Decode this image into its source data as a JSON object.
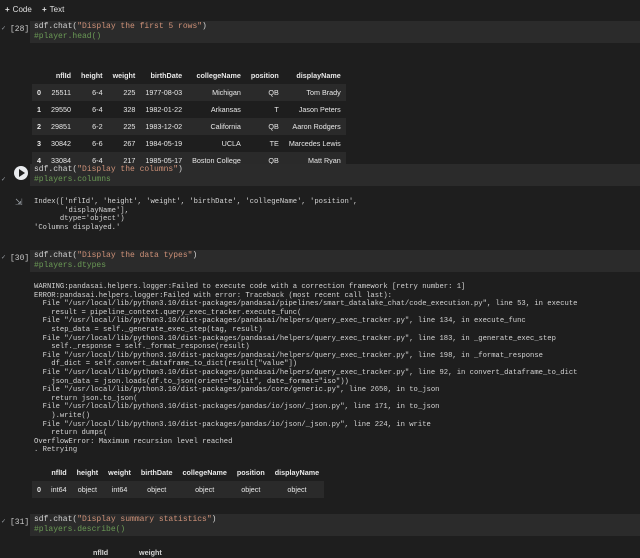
{
  "toolbar": {
    "add_code": "Code",
    "add_text": "Text"
  },
  "cells": {
    "c1": {
      "count": "[28]",
      "code1_fn": "sdf.chat(",
      "code1_str": "\"Display the first 5 rows\"",
      "code1_end": ")",
      "code2": "#player.head()",
      "table": {
        "columns": [
          "",
          "nflId",
          "height",
          "weight",
          "birthDate",
          "collegeName",
          "position",
          "displayName"
        ],
        "rows": [
          [
            "0",
            "25511",
            "6-4",
            "225",
            "1977-08-03",
            "Michigan",
            "QB",
            "Tom Brady"
          ],
          [
            "1",
            "29550",
            "6-4",
            "328",
            "1982-01-22",
            "Arkansas",
            "T",
            "Jason Peters"
          ],
          [
            "2",
            "29851",
            "6-2",
            "225",
            "1983-12-02",
            "California",
            "QB",
            "Aaron Rodgers"
          ],
          [
            "3",
            "30842",
            "6-6",
            "267",
            "1984-05-19",
            "UCLA",
            "TE",
            "Marcedes Lewis"
          ],
          [
            "4",
            "33084",
            "6-4",
            "217",
            "1985-05-17",
            "Boston College",
            "QB",
            "Matt Ryan"
          ]
        ]
      }
    },
    "c2": {
      "code1_fn": "sdf.chat(",
      "code1_str": "\"Display the columns\"",
      "code1_end": ")",
      "code2": "#players.columns",
      "out": [
        "Index(['nflId', 'height', 'weight', 'birthDate', 'collegeName', 'position',",
        "       'displayName'],",
        "      dtype='object')",
        "'Columns displayed.'"
      ]
    },
    "c3": {
      "count": "[30]",
      "code1_fn": "sdf.chat(",
      "code1_str": "\"Display the data types\"",
      "code1_end": ")",
      "code2": "#players.dtypes",
      "out": [
        "WARNING:pandasai.helpers.logger:Failed to execute code with a correction framework [retry number: 1]",
        "ERROR:pandasai.helpers.logger:Failed with error: Traceback (most recent call last):",
        "  File \"/usr/local/lib/python3.10/dist-packages/pandasai/pipelines/smart_datalake_chat/code_execution.py\", line 53, in execute",
        "    result = pipeline_context.query_exec_tracker.execute_func(",
        "  File \"/usr/local/lib/python3.10/dist-packages/pandasai/helpers/query_exec_tracker.py\", line 134, in execute_func",
        "    step_data = self._generate_exec_step(tag, result)",
        "  File \"/usr/local/lib/python3.10/dist-packages/pandasai/helpers/query_exec_tracker.py\", line 183, in _generate_exec_step",
        "    self._response = self._format_response(result)",
        "  File \"/usr/local/lib/python3.10/dist-packages/pandasai/helpers/query_exec_tracker.py\", line 198, in _format_response",
        "    df_dict = self.convert_dataframe_to_dict(result[\"value\"])",
        "  File \"/usr/local/lib/python3.10/dist-packages/pandasai/helpers/query_exec_tracker.py\", line 92, in convert_dataframe_to_dict",
        "    json_data = json.loads(df.to_json(orient=\"split\", date_format=\"iso\"))",
        "  File \"/usr/local/lib/python3.10/dist-packages/pandas/core/generic.py\", line 2650, in to_json",
        "    return json.to_json(",
        "  File \"/usr/local/lib/python3.10/dist-packages/pandas/io/json/_json.py\", line 171, in to_json",
        "    ).write()",
        "  File \"/usr/local/lib/python3.10/dist-packages/pandas/io/json/_json.py\", line 224, in write",
        "    return dumps(",
        "OverflowError: Maximum recursion level reached",
        ". Retrying"
      ],
      "table": {
        "columns": [
          "",
          "nflId",
          "height",
          "weight",
          "birthDate",
          "collegeName",
          "position",
          "displayName"
        ],
        "rows": [
          [
            "0",
            "int64",
            "object",
            "int64",
            "object",
            "object",
            "object",
            "object"
          ]
        ]
      }
    },
    "c4": {
      "count": "[31]",
      "code1_fn": "sdf.chat(",
      "code1_str": "\"Display summary statistics\"",
      "code1_end": ")",
      "code2": "#players.describe()",
      "partial_header": [
        "nflId",
        "weight"
      ]
    }
  }
}
